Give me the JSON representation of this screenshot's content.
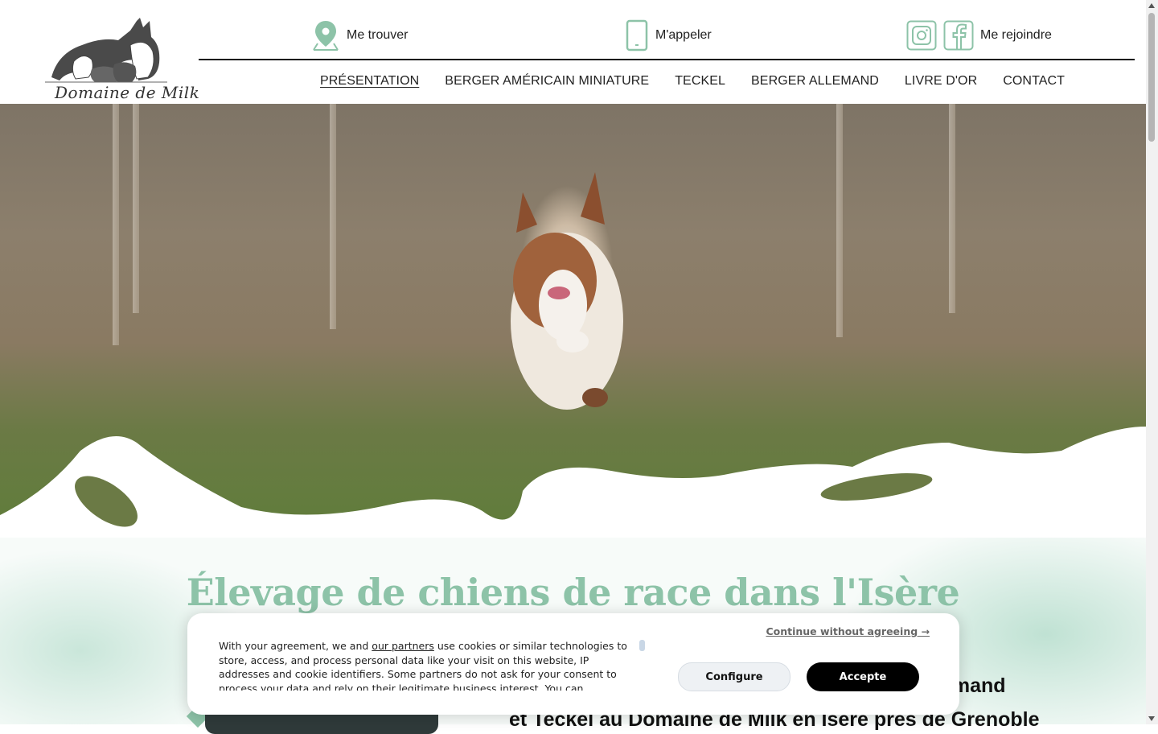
{
  "brand": {
    "logo_text": "Domaine de Milk",
    "logo_icon": "dog-silhouettes-logo"
  },
  "contact": {
    "locate_label": "Me trouver",
    "locate_icon": "map-pin-icon",
    "call_label": "M'appeler",
    "call_icon": "phone-icon",
    "join_label": "Me rejoindre",
    "instagram_icon": "instagram-icon",
    "facebook_icon": "facebook-icon"
  },
  "nav": {
    "items": [
      {
        "label": "PRÉSENTATION",
        "active": true
      },
      {
        "label": "BERGER AMÉRICAIN MINIATURE",
        "active": false
      },
      {
        "label": "TECKEL",
        "active": false
      },
      {
        "label": "BERGER ALLEMAND",
        "active": false
      },
      {
        "label": "LIVRE D'OR",
        "active": false
      },
      {
        "label": "CONTACT",
        "active": false
      }
    ]
  },
  "main": {
    "headline": "Élevage de chiens de race dans l'Isère",
    "subtitle_line1": "emand",
    "subtitle_line2": "et Teckel au Domaine de Milk en Isère près de Grenoble"
  },
  "cookie": {
    "text_before": "With your agreement, we and ",
    "partners_link": "our partners",
    "text_after": " use cookies or similar technologies to store, access, and process personal data like your visit on this website, IP addresses and cookie identifiers. Some partners do not ask for your consent to process your data and rely on their legitimate business interest. You can",
    "continue_label": "Continue without agreeing →",
    "configure_label": "Configure",
    "accept_label": "Accepte"
  },
  "colors": {
    "accent": "#8dc3a8",
    "text": "#222222",
    "button_dark": "#000000"
  }
}
